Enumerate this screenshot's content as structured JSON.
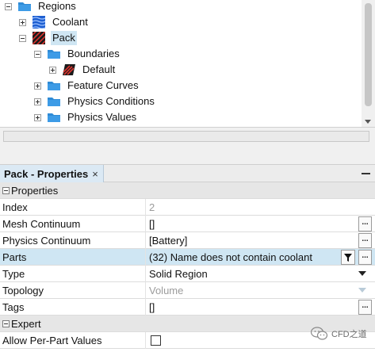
{
  "tree": {
    "items": [
      {
        "label": "Regions"
      },
      {
        "label": "Coolant"
      },
      {
        "label": "Pack"
      },
      {
        "label": "Boundaries"
      },
      {
        "label": "Default"
      },
      {
        "label": "Feature Curves"
      },
      {
        "label": "Physics Conditions"
      },
      {
        "label": "Physics Values"
      }
    ]
  },
  "properties_panel": {
    "title": "Pack - Properties",
    "close_glyph": "×"
  },
  "properties": {
    "section_properties": "Properties",
    "section_expert": "Expert",
    "rows": [
      {
        "name": "Index",
        "value": "2"
      },
      {
        "name": "Mesh Continuum",
        "value": "[]"
      },
      {
        "name": "Physics Continuum",
        "value": "[Battery]"
      },
      {
        "name": "Parts",
        "value": "(32) Name does not contain coolant"
      },
      {
        "name": "Type",
        "value": "Solid Region"
      },
      {
        "name": "Topology",
        "value": "Volume"
      },
      {
        "name": "Tags",
        "value": "[]"
      },
      {
        "name": "Allow Per-Part Values",
        "value": ""
      }
    ],
    "ellipsis_label": "..."
  },
  "watermark": {
    "text": "CFD之道"
  },
  "colors": {
    "selection": "#cfe6f3",
    "folder": "#2f8bd6",
    "section_bg": "#e6e6e6"
  }
}
